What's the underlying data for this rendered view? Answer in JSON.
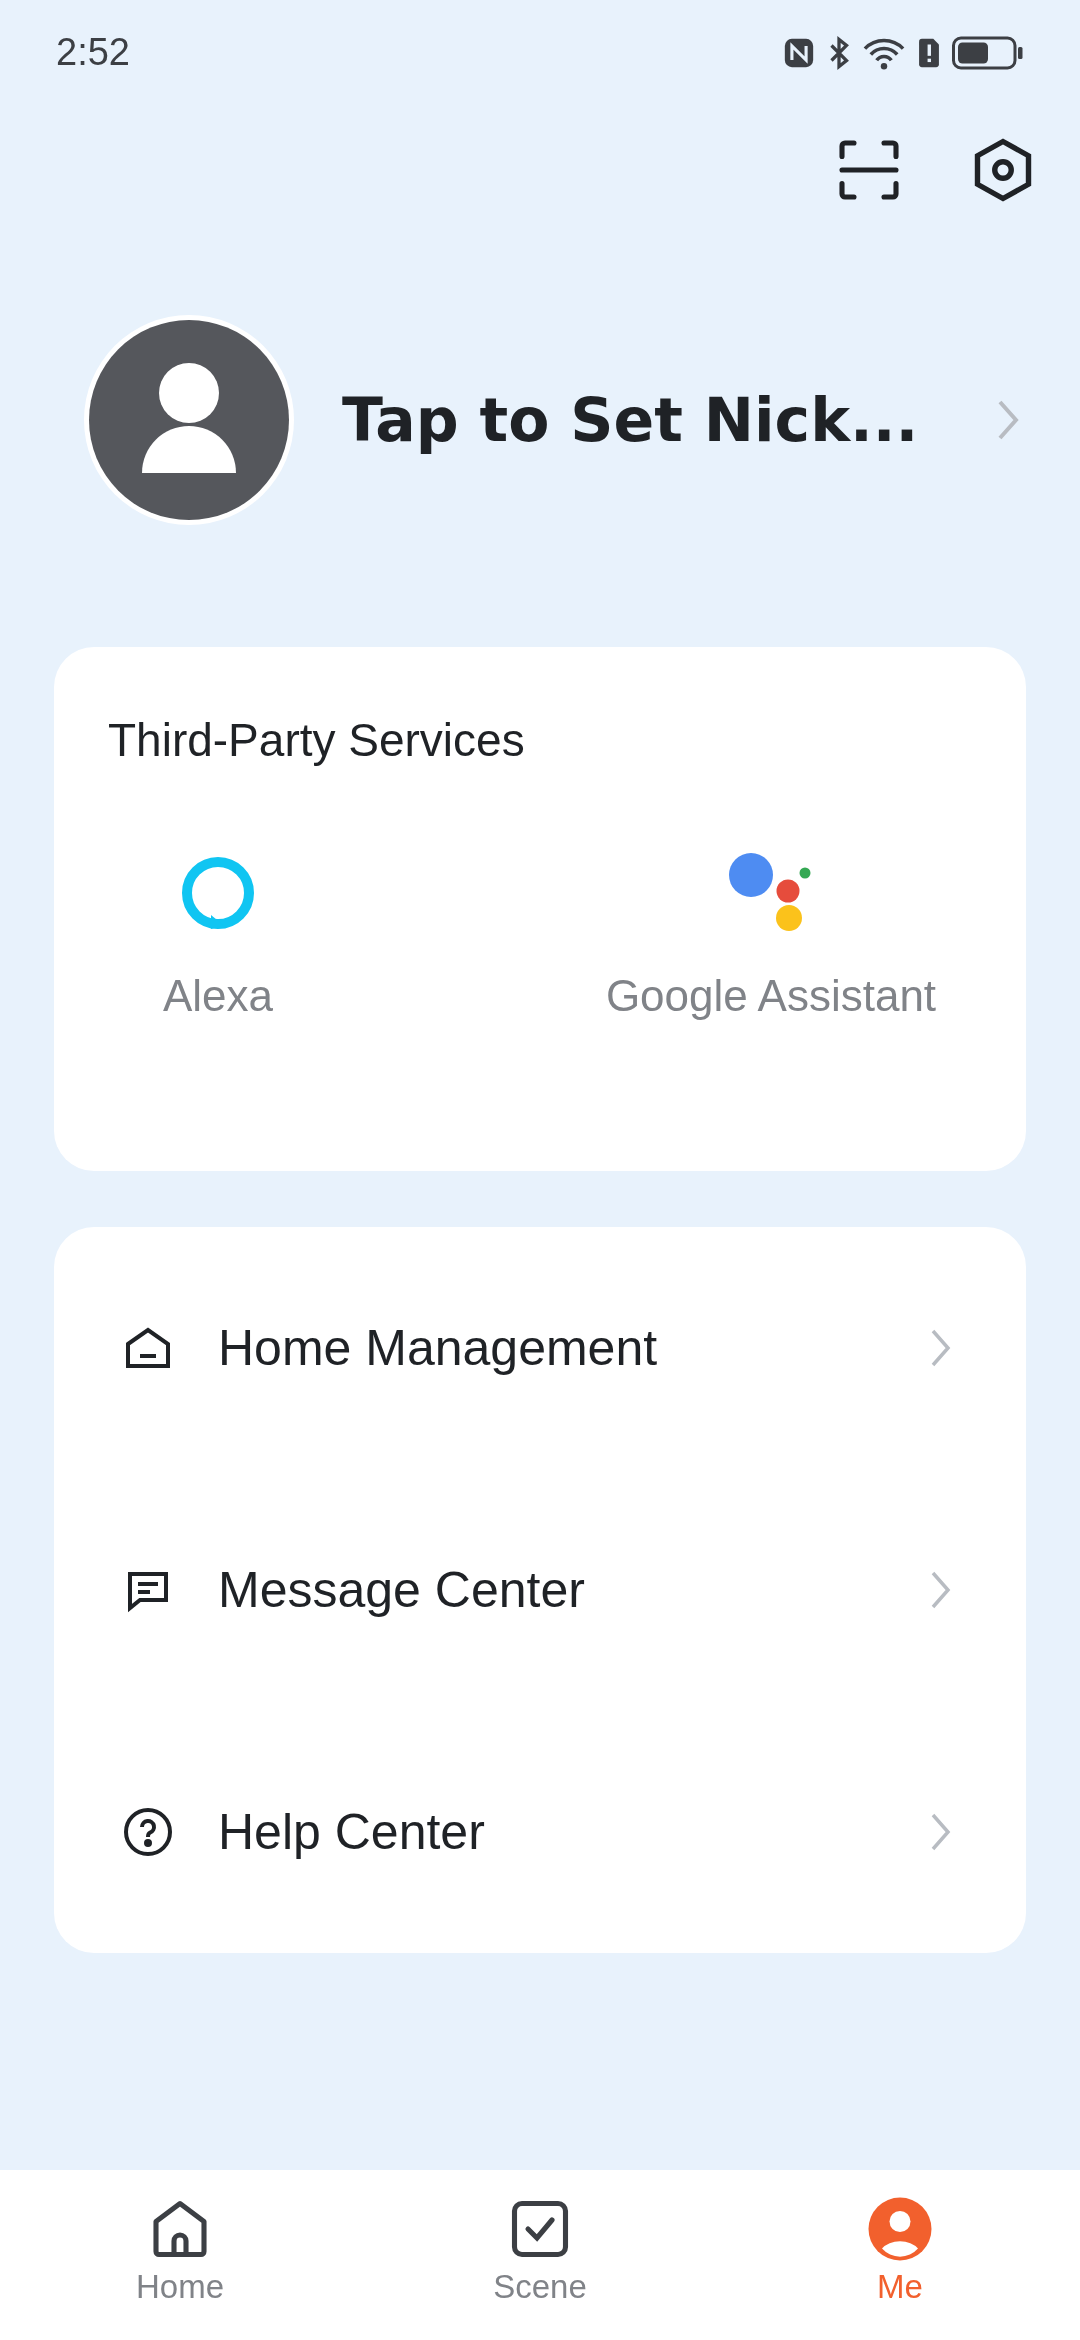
{
  "status_bar": {
    "time": "2:52"
  },
  "profile": {
    "name": "Tap to Set Nick..."
  },
  "third_party": {
    "title": "Third-Party Services",
    "services": [
      {
        "kind": "alexa",
        "label": "Alexa"
      },
      {
        "kind": "google",
        "label": "Google Assistant"
      }
    ]
  },
  "menu": [
    {
      "kind": "home",
      "label": "Home Management"
    },
    {
      "kind": "message",
      "label": "Message Center"
    },
    {
      "kind": "help",
      "label": "Help Center"
    }
  ],
  "tab_bar": [
    {
      "kind": "home",
      "label": "Home",
      "selected": false
    },
    {
      "kind": "scene",
      "label": "Scene",
      "selected": false
    },
    {
      "kind": "me",
      "label": "Me",
      "selected": true
    }
  ]
}
